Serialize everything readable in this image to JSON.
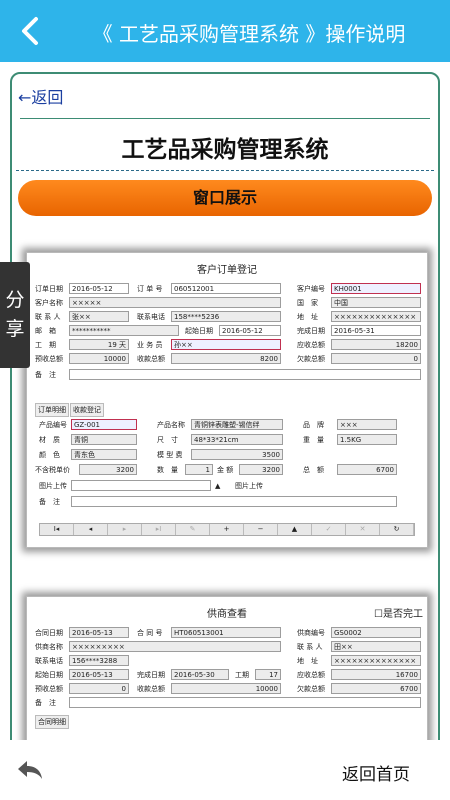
{
  "header": {
    "title": "《 工艺品采购管理系统 》操作说明"
  },
  "side_tab": {
    "label_1": "分",
    "label_2": "享"
  },
  "content": {
    "return_link": "←返回",
    "heading": "工艺品采购管理系统",
    "section_bar": "窗口展示"
  },
  "screenshot1": {
    "title": "客户订单登记",
    "r1": {
      "l1": "订单日期",
      "v1": "2016-05-12",
      "l2": "订 单 号",
      "v2": "060512001",
      "l3": "客户编号",
      "v3": "KH0001"
    },
    "r2": {
      "l1": "客户名称",
      "v1": "×××××",
      "l3": "国　家",
      "v3": "中国"
    },
    "r3": {
      "l1": "联 系 人",
      "v1": "张××",
      "l2": "联系电话",
      "v2": "158****5236",
      "l3": "地　址",
      "v3": "××××××××××××××"
    },
    "r4": {
      "l1": "邮　箱",
      "v1": "***********",
      "l2": "起始日期",
      "v2": "2016-05-12",
      "l3": "完成日期",
      "v3": "2016-05-31"
    },
    "r5": {
      "l1": "工　期",
      "v1": "19 天",
      "l2": "业 务 员",
      "v2": "孙××",
      "l3": "应收总额",
      "v3": "18200"
    },
    "r6": {
      "l1": "预收总额",
      "v1": "10000",
      "l2": "收款总额",
      "v2": "8200",
      "l3": "欠款总额",
      "v3": "0"
    },
    "r7": {
      "l1": "备　注"
    },
    "tab1": "订单明细",
    "tab2": "收款登记",
    "d1": {
      "l1": "产品编号",
      "v1": "GZ-001",
      "l2": "产品名称",
      "v2": "青铜锌表雕塑-锡信绊",
      "l3": "品　牌",
      "v3": "×××"
    },
    "d2": {
      "l1": "材　质",
      "v1": "青铜",
      "l2": "尺　寸",
      "v2": "48*33*21cm",
      "l3": "重　量",
      "v3": "1.5KG"
    },
    "d3": {
      "l1": "颜　色",
      "v1": "青东色",
      "l2": "模 型 费",
      "v2": "3500"
    },
    "d4": {
      "l1": "不含税单价",
      "v1": "3200",
      "l2": "数　量",
      "v2": "1",
      "l2b": "金 额",
      "v2b": "3200",
      "l3": "总　额",
      "v3": "6700"
    },
    "d5": {
      "l1": "图片上传",
      "l2": "图片上传"
    },
    "d6": {
      "l1": "备　注"
    },
    "nav": [
      "I◂",
      "◂",
      "▸",
      "▸I",
      "✎",
      "+",
      "−",
      "▲",
      "✓",
      "✕",
      "↻"
    ]
  },
  "screenshot2": {
    "title": "供商查看",
    "checkbox_label": "☐是否完工",
    "r1": {
      "l1": "合同日期",
      "v1": "2016-05-13",
      "l2": "合 同 号",
      "v2": "HT060513001",
      "l3": "供商编号",
      "v3": "GS0002"
    },
    "r2": {
      "l1": "供商名称",
      "v1": "×××××××××",
      "l3": "联 系 人",
      "v3": "田××"
    },
    "r3": {
      "l1": "联系电话",
      "v1": "156****3288",
      "l3": "地　址",
      "v3": "××××××××××××××"
    },
    "r4": {
      "l1": "起始日期",
      "v1": "2016-05-13",
      "l2": "完成日期",
      "v2": "2016-05-30",
      "l2b": "工期",
      "v2b": "17",
      "l3": "应收总额",
      "v3": "16700"
    },
    "r5": {
      "l1": "预收总额",
      "v1": "0",
      "l2": "收款总额",
      "v2": "10000",
      "l3": "欠款总额",
      "v3": "6700"
    },
    "r6": {
      "l1": "备　注"
    },
    "tab1": "合同明细"
  },
  "footer": {
    "home_label": "返回首页"
  },
  "icons": {
    "back": "chevron-left-icon",
    "footer_back": "reply-arrow-icon"
  },
  "colors": {
    "header": "#2eb4ea",
    "accent_orange": "#f07a10",
    "frame_border": "#3d8c74"
  }
}
